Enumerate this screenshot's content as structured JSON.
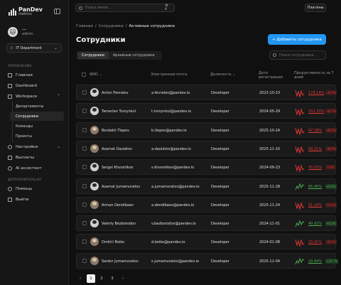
{
  "app": {
    "logo_line1": "PanDev",
    "logo_line2": "metrics"
  },
  "user": {
    "name": "—",
    "role": "admin"
  },
  "department": {
    "label": "IT Department"
  },
  "sidebar": {
    "section_management": "УПРАВЛЕНИЕ",
    "section_additional": "ДОПОЛНИТЕЛЬНО",
    "items": [
      {
        "label": "Главная",
        "icon": "home-icon"
      },
      {
        "label": "Dashboard",
        "icon": "grid-icon"
      },
      {
        "label": "Workspace",
        "icon": "briefcase-icon"
      },
      {
        "label": "Настройки",
        "icon": "gear-icon"
      },
      {
        "label": "Выплаты",
        "icon": "wallet-icon"
      },
      {
        "label": "AI ассистент",
        "icon": "sparkle-icon"
      },
      {
        "label": "Помощь",
        "icon": "help-icon"
      },
      {
        "label": "Выйти",
        "icon": "logout-icon"
      }
    ],
    "workspace_sub": [
      "Департаменты",
      "Сотрудники",
      "Команды",
      "Проекты"
    ]
  },
  "topbar": {
    "search_placeholder": "Поиск меню...",
    "shortcut": "⌘ K",
    "settings_label": "Плагины"
  },
  "breadcrumb": [
    "Главная",
    "/",
    "Сотрудники",
    "/",
    "Активные сотрудники"
  ],
  "page": {
    "title": "Сотрудники",
    "add_button": "+ Добавить сотрудника",
    "tabs": [
      "Сотрудники",
      "Архивные сотрудники"
    ],
    "emp_search_placeholder": "Поиск сотрудника..."
  },
  "table": {
    "headers": {
      "name": "ФИО",
      "email": "Электронная почта",
      "role": "Должность",
      "date": "Дата регистрации",
      "productivity": "Продуктивность за 7 дней"
    },
    "rows": [
      {
        "name": "Anton Fevralev",
        "email": "a.fevralev@pandev.io",
        "role": "Developer",
        "date": "2023-10-23",
        "pct": "174.14%",
        "delta": "-35.5%",
        "trend": "down",
        "avatar": "cat"
      },
      {
        "name": "Tamerlan Tursynkul",
        "email": "t.tursynkul@pandev.io",
        "role": "Developer",
        "date": "2024-05-29",
        "pct": "152.33%",
        "delta": "-44.7%",
        "trend": "down",
        "avatar": "cat"
      },
      {
        "name": "Berdakh Tlepov",
        "email": "b.tlepov@pandev.io",
        "role": "Developer",
        "date": "2025-10-24",
        "pct": "97.28%",
        "delta": "-45.5%",
        "trend": "down",
        "avatar": "photo"
      },
      {
        "name": "Azamat Daulatov",
        "email": "a.daulatov@pandev.io",
        "role": "Developer",
        "date": "2025-11-10",
        "pct": "89.21%",
        "delta": "-48.5%",
        "trend": "down",
        "avatar": "photo"
      },
      {
        "name": "Sergei Khvostikov",
        "email": "s.khvostikov@pandev.io",
        "role": "Developer",
        "date": "2024-09-23",
        "pct": "70.15%",
        "delta": "-7.9%",
        "trend": "down",
        "avatar": "cat"
      },
      {
        "name": "Azamat Jumamuratov",
        "email": "a.jumamuratov@pandev.io",
        "role": "Developer",
        "date": "2025-11-28",
        "pct": "65.40%",
        "delta": "+8.4%",
        "trend": "up",
        "avatar": "cat"
      },
      {
        "name": "Arman Dendibaev",
        "email": "a.dendibaev@pandev.io",
        "role": "Developer",
        "date": "2025-11-24",
        "pct": "51.19%",
        "delta": "-14.3%",
        "trend": "down",
        "avatar": "photo"
      },
      {
        "name": "Valeriy Bezborodov",
        "email": "v.bezborodov@pandev.io",
        "role": "Developer",
        "date": "2024-11-01",
        "pct": "40.92%",
        "delta": "+8.3%",
        "trend": "up",
        "avatar": "cat"
      },
      {
        "name": "Dmitrii Boiko",
        "email": "d.boiko@pandev.io",
        "role": "Developer",
        "date": "2024-01-08",
        "pct": "33.41%",
        "delta": "-20.1%",
        "trend": "down",
        "avatar": "photo"
      },
      {
        "name": "Sardor Jumamuratov",
        "email": "s.jumamuratov@pandev.io",
        "role": "Developer",
        "date": "2025-11-04",
        "pct": "29.94%",
        "delta": "+20.7%",
        "trend": "up",
        "avatar": "photo"
      }
    ]
  },
  "pagination": {
    "prev": "‹",
    "pages": [
      "1",
      "2",
      "3"
    ],
    "next": "›",
    "current": "1"
  },
  "colors": {
    "accent": "#2196f3",
    "up": "#4caf50",
    "down": "#e53935"
  }
}
